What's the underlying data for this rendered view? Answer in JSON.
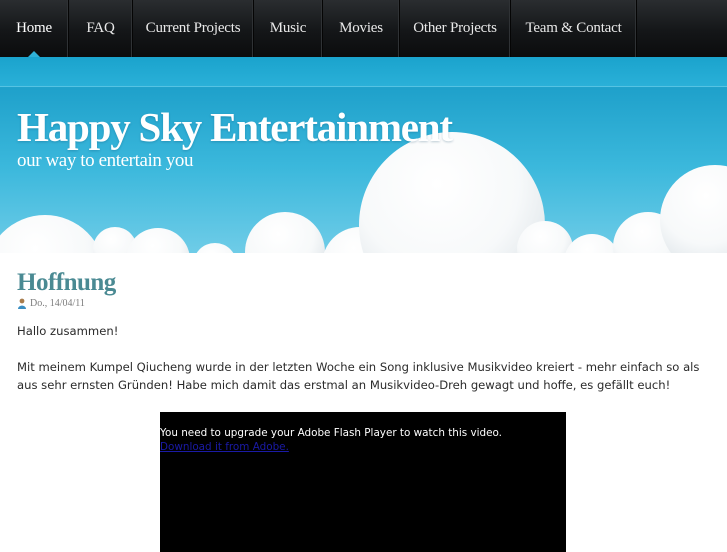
{
  "nav": {
    "items": [
      {
        "label": "Home",
        "active": true
      },
      {
        "label": "FAQ"
      },
      {
        "label": "Current Projects"
      },
      {
        "label": "Music"
      },
      {
        "label": "Movies"
      },
      {
        "label": "Other Projects"
      },
      {
        "label": "Team & Contact"
      }
    ]
  },
  "header": {
    "title": "Happy Sky Entertainment",
    "tagline": "our way to entertain you"
  },
  "post": {
    "title": "Hoffnung",
    "meta_icon": "user-icon",
    "date": "Do., 14/04/11",
    "greeting": "Hallo zusammen!",
    "body": "Mit meinem Kumpel Qiucheng wurde in der letzten Woche ein Song inklusive Musikvideo kreiert - mehr einfach so als aus sehr ernsten Gründen! Habe mich damit das erstmal an Musikvideo-Dreh gewagt und hoffe, es gefällt euch!"
  },
  "video": {
    "message": "You need to upgrade your Adobe Flash Player to watch this video.",
    "link_label": "Download it from Adobe."
  },
  "colors": {
    "nav_bg": "#141618",
    "sky": "#22a4cc",
    "title_teal": "#4a8a93",
    "video_bg": "#000000"
  }
}
